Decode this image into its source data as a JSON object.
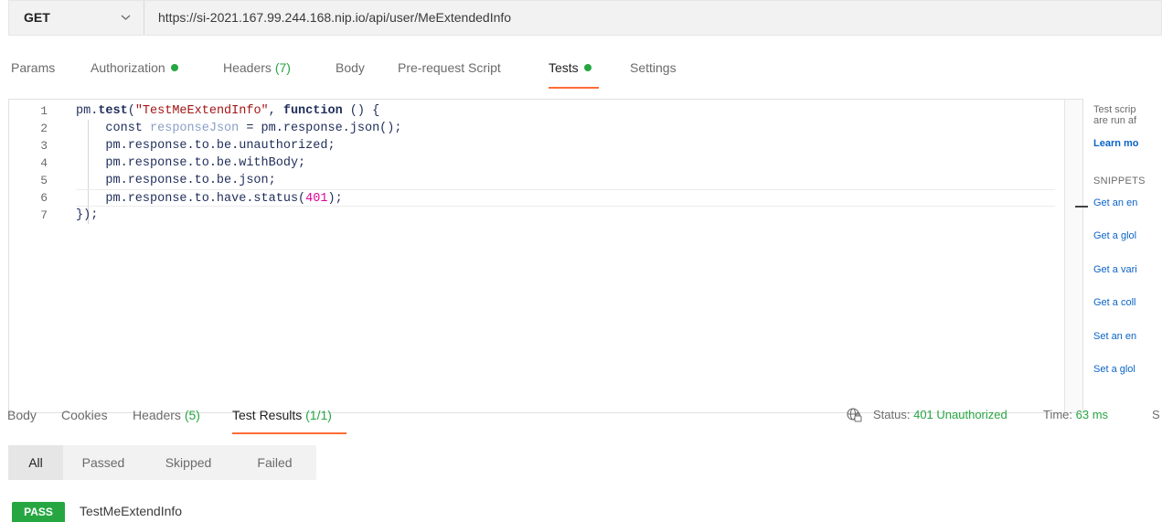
{
  "request": {
    "method": "GET",
    "url": "https://si-2021.167.99.244.168.nip.io/api/user/MeExtendedInfo"
  },
  "request_tabs": [
    {
      "label": "Params"
    },
    {
      "label": "Authorization",
      "dot": true
    },
    {
      "label": "Headers",
      "count": "(7)"
    },
    {
      "label": "Body"
    },
    {
      "label": "Pre-request Script"
    },
    {
      "label": "Tests",
      "dot": true,
      "active": true
    },
    {
      "label": "Settings"
    }
  ],
  "editor": {
    "line_numbers": [
      "1",
      "2",
      "3",
      "4",
      "5",
      "6",
      "7"
    ],
    "lines": [
      "pm.test(\"TestMeExtendInfo\", function () {",
      "    const responseJson = pm.response.json();",
      "    pm.response.to.be.unauthorized;",
      "    pm.response.to.be.withBody;",
      "    pm.response.to.be.json;",
      "    pm.response.to.have.status(401);",
      "});"
    ]
  },
  "side_panel": {
    "desc_line1": "Test scrip",
    "desc_line2": "are run af",
    "learn_more": "Learn mo",
    "snippets_heading": "SNIPPETS",
    "snippets": [
      "Get an en",
      "Get a glol",
      "Get a vari",
      "Get a coll",
      "Set an en",
      "Set a glol"
    ]
  },
  "response_tabs": [
    {
      "label": "Body"
    },
    {
      "label": "Cookies"
    },
    {
      "label": "Headers",
      "count": "(5)"
    },
    {
      "label": "Test Results",
      "count": "(1/1)",
      "active": true
    }
  ],
  "status": {
    "status_label": "Status:",
    "status_value": "401 Unauthorized",
    "time_label": "Time:",
    "time_value": "63 ms",
    "size_label": "S"
  },
  "filters": [
    {
      "label": "All",
      "active": true
    },
    {
      "label": "Passed"
    },
    {
      "label": "Skipped"
    },
    {
      "label": "Failed"
    }
  ],
  "result": {
    "badge": "PASS",
    "name": "TestMeExtendInfo"
  },
  "colors": {
    "accent": "#ff6c37",
    "success": "#26a641",
    "link": "#0c64c8"
  }
}
